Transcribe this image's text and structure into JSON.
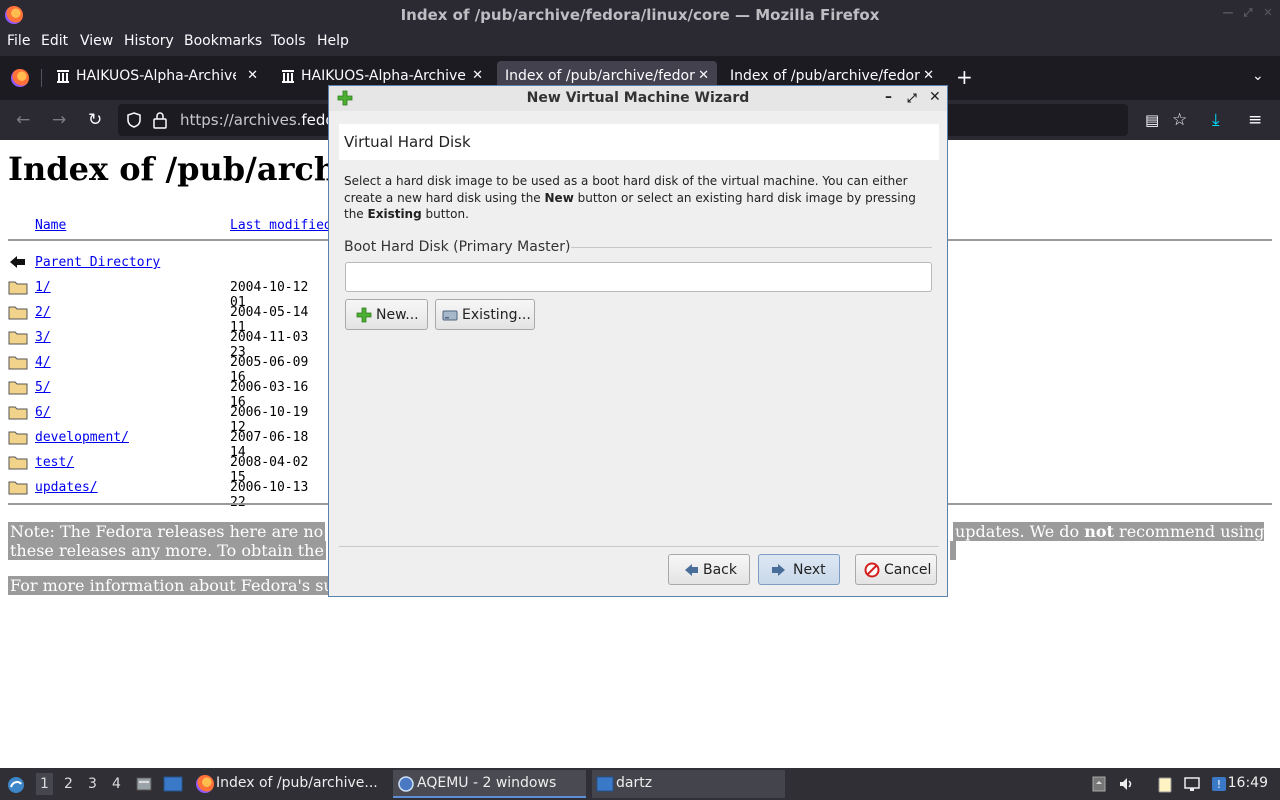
{
  "window": {
    "title": "Index of /pub/archive/fedora/linux/core — Mozilla Firefox"
  },
  "menubar": {
    "items": [
      "File",
      "Edit",
      "View",
      "History",
      "Bookmarks",
      "Tools",
      "Help"
    ]
  },
  "tabs": [
    {
      "label": "HAIKUOS-Alpha-Archive ·",
      "active": false
    },
    {
      "label": "HAIKUOS-Alpha-Archive ·",
      "active": false
    },
    {
      "label": "Index of /pub/archive/fedora",
      "active": true
    },
    {
      "label": "Index of /pub/archive/fedora",
      "active": false
    }
  ],
  "navbar": {
    "url_prefix": "https://archives.",
    "url_host": "fedo"
  },
  "page": {
    "heading": "Index of /pub/archi",
    "columns": {
      "name": "Name",
      "last_modified": "Last modified"
    },
    "parent": "Parent Directory",
    "rows": [
      {
        "name": "1/",
        "date": "2004-10-12 01"
      },
      {
        "name": "2/",
        "date": "2004-05-14 11"
      },
      {
        "name": "3/",
        "date": "2004-11-03 23"
      },
      {
        "name": "4/",
        "date": "2005-06-09 16"
      },
      {
        "name": "5/",
        "date": "2006-03-16 16"
      },
      {
        "name": "6/",
        "date": "2006-10-19 12"
      },
      {
        "name": "development/",
        "date": "2007-06-18 14"
      },
      {
        "name": "test/",
        "date": "2008-04-02 15"
      },
      {
        "name": "updates/",
        "date": "2006-10-13 22"
      }
    ],
    "note1_left": "Note: The Fedora releases here are no",
    "note1_right_pre": "updates. We do ",
    "note1_right_bold": "not",
    "note1_right_post": " recommend using",
    "note2_left": "these releases any more. To obtain the",
    "note3_left": "For more information about Fedora's su"
  },
  "dialog": {
    "title": "New Virtual Machine Wizard",
    "header": "Virtual Hard Disk",
    "desc_part1": "Select a hard disk image to be used as a boot hard disk of the virtual machine. You can either create a new hard disk using the ",
    "desc_bold1": "New",
    "desc_part2": " button or select an existing hard disk image by pressing the ",
    "desc_bold2": "Existing",
    "desc_part3": " button.",
    "group_label": "Boot Hard Disk (Primary Master)",
    "field_value": "",
    "buttons": {
      "new": "New...",
      "existing": "Existing...",
      "back": "Back",
      "next": "Next",
      "cancel": "Cancel"
    }
  },
  "taskbar": {
    "workspaces": [
      "1",
      "2",
      "3",
      "4"
    ],
    "tasks": [
      {
        "label": "Index of /pub/archive...",
        "active": false
      },
      {
        "label": "AQEMU - 2 windows",
        "active": true
      },
      {
        "label": "dartz",
        "active": false
      }
    ],
    "clock": "16:49"
  }
}
